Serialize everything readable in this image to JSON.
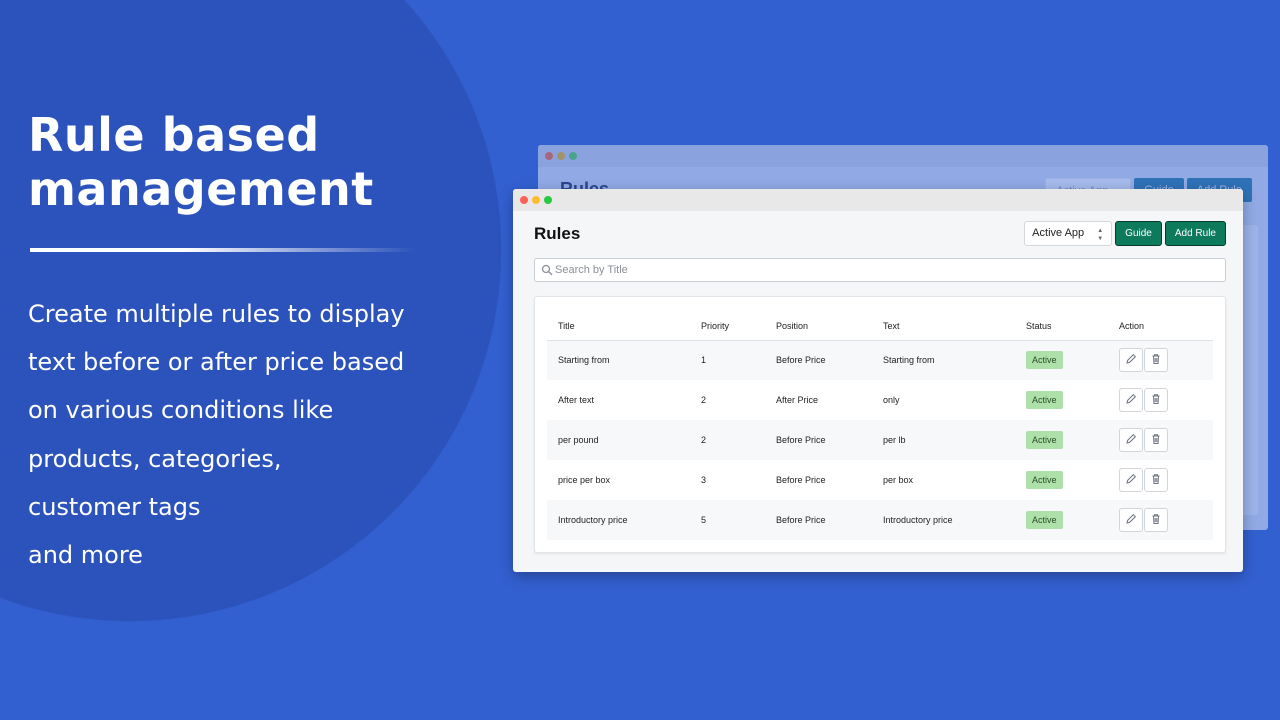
{
  "hero": {
    "title_line1": "Rule based",
    "title_line2": "management",
    "description": [
      "Create multiple rules to display",
      "text before or after price based",
      "on various conditions like",
      "products, categories,",
      "customer tags",
      "and more"
    ]
  },
  "back_window": {
    "title": "Rules",
    "select": "Active App",
    "guide": "Guide",
    "add": "Add Rule"
  },
  "app": {
    "title": "Rules",
    "select_value": "Active App",
    "guide_label": "Guide",
    "add_rule_label": "Add Rule",
    "search_placeholder": "Search by Title",
    "columns": [
      "Title",
      "Priority",
      "Position",
      "Text",
      "Status",
      "Action"
    ],
    "rows": [
      {
        "title": "Starting from",
        "priority": "1",
        "position": "Before Price",
        "text": "Starting from",
        "status": "Active"
      },
      {
        "title": "After text",
        "priority": "2",
        "position": "After Price",
        "text": "only",
        "status": "Active"
      },
      {
        "title": "per pound",
        "priority": "2",
        "position": "Before Price",
        "text": "per lb",
        "status": "Active"
      },
      {
        "title": "price per box",
        "priority": "3",
        "position": "Before Price",
        "text": "per box",
        "status": "Active"
      },
      {
        "title": "Introductory price",
        "priority": "5",
        "position": "Before Price",
        "text": "Introductory price",
        "status": "Active"
      }
    ]
  },
  "colors": {
    "background": "#3360d1",
    "circle": "#2b53bb",
    "primary_button": "#0d7a5c",
    "badge": "#aee1a9"
  },
  "icons": {
    "search": "search-icon",
    "edit": "pencil-icon",
    "delete": "trash-icon"
  }
}
